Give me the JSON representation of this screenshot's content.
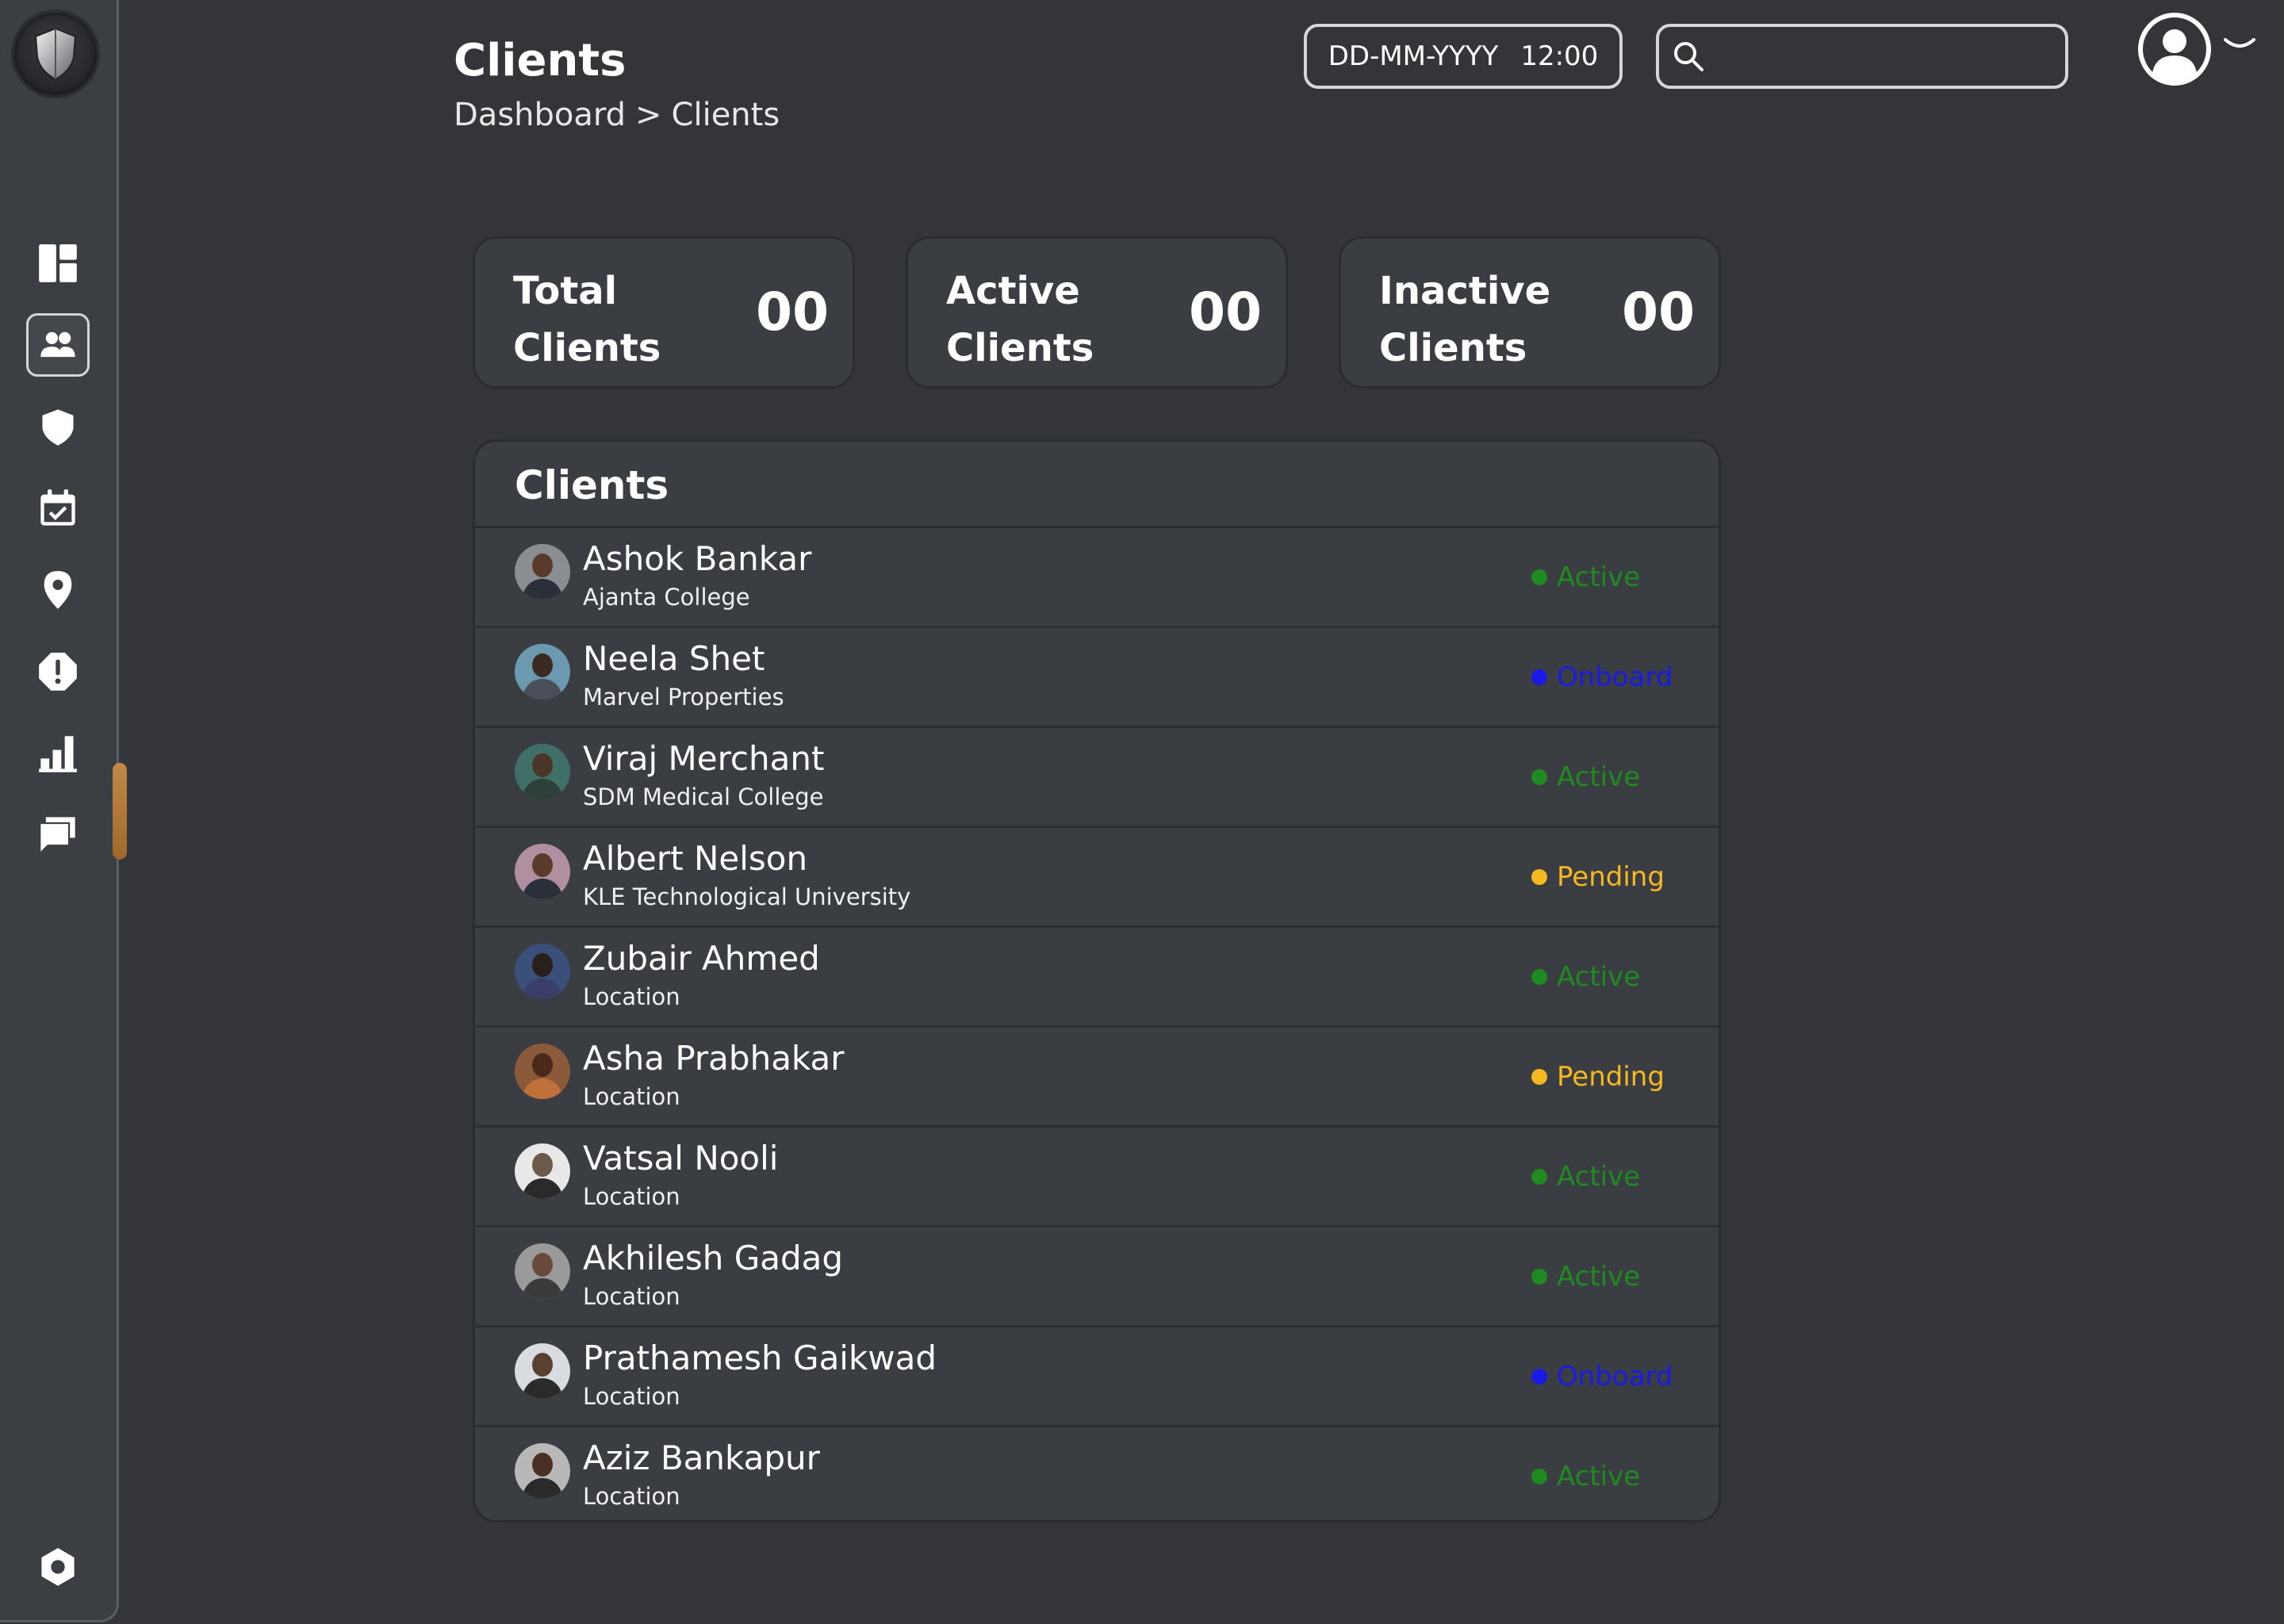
{
  "header": {
    "title": "Clients",
    "breadcrumb": {
      "parent": "Dashboard",
      "separator": ">",
      "current": "Clients"
    },
    "date": "DD-MM-YYYY",
    "time": "12:00",
    "search_placeholder": ""
  },
  "sidebar": {
    "items": [
      {
        "icon": "dashboard-icon"
      },
      {
        "icon": "clients-icon",
        "active": true
      },
      {
        "icon": "shield-icon"
      },
      {
        "icon": "calendar-check-icon"
      },
      {
        "icon": "location-pin-icon"
      },
      {
        "icon": "alert-icon"
      },
      {
        "icon": "bar-chart-icon"
      },
      {
        "icon": "messages-icon"
      }
    ],
    "bottom_icon": "settings-icon"
  },
  "stats": [
    {
      "line1": "Total",
      "line2": "Clients",
      "value": "00"
    },
    {
      "line1": "Active",
      "line2": "Clients",
      "value": "00"
    },
    {
      "line1": "Inactive",
      "line2": "Clients",
      "value": "00"
    }
  ],
  "clients_panel": {
    "title": "Clients",
    "rows": [
      {
        "name": "Ashok Bankar",
        "org": "Ajanta College",
        "status": "Active"
      },
      {
        "name": "Neela Shet",
        "org": "Marvel Properties",
        "status": "Onboard"
      },
      {
        "name": "Viraj Merchant",
        "org": "SDM Medical College",
        "status": "Active"
      },
      {
        "name": "Albert Nelson",
        "org": "KLE Technological University",
        "status": "Pending"
      },
      {
        "name": "Zubair Ahmed",
        "org": "Location",
        "status": "Active"
      },
      {
        "name": "Asha Prabhakar",
        "org": "Location",
        "status": "Pending"
      },
      {
        "name": "Vatsal Nooli",
        "org": "Location",
        "status": "Active"
      },
      {
        "name": "Akhilesh Gadag",
        "org": "Location",
        "status": "Active"
      },
      {
        "name": "Prathamesh Gaikwad",
        "org": "Location",
        "status": "Onboard"
      },
      {
        "name": "Aziz Bankapur",
        "org": "Location",
        "status": "Active"
      }
    ]
  },
  "colors": {
    "background": "#333539",
    "sidebar": "#3b3e42",
    "card": "#3a3d41",
    "status_active": "#1f8a1f",
    "status_onboard": "#1a1ae6",
    "status_pending": "#f5b820",
    "accent_handle": "#b57a3a"
  }
}
